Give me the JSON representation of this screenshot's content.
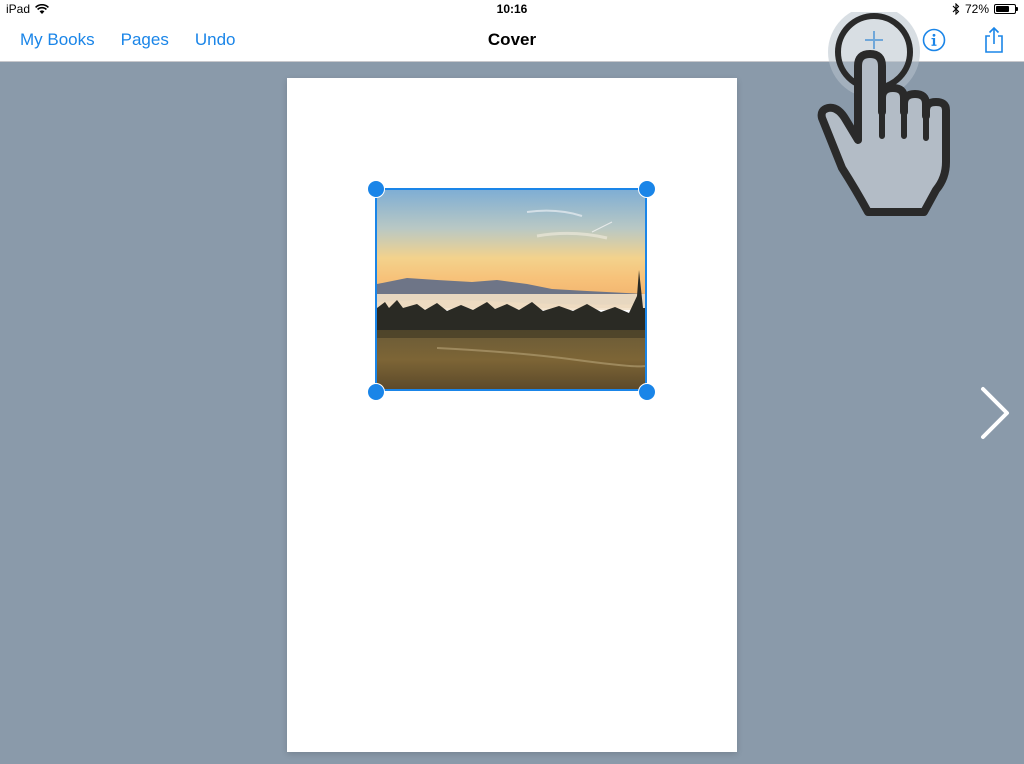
{
  "status_bar": {
    "device": "iPad",
    "time": "10:16",
    "battery_percent_label": "72%",
    "battery_level": 0.72
  },
  "nav_bar": {
    "left_buttons": [
      "My Books",
      "Pages",
      "Undo"
    ],
    "title": "Cover",
    "right_icons": [
      "add-icon",
      "info-icon",
      "share-icon"
    ]
  },
  "canvas": {
    "selected_item": "photo",
    "photo_description_icon": "landscape-sunset-photo"
  },
  "colors": {
    "accent": "#1a85e8",
    "background": "#8a9aaa",
    "bar": "#ffffff",
    "page": "#ffffff"
  }
}
